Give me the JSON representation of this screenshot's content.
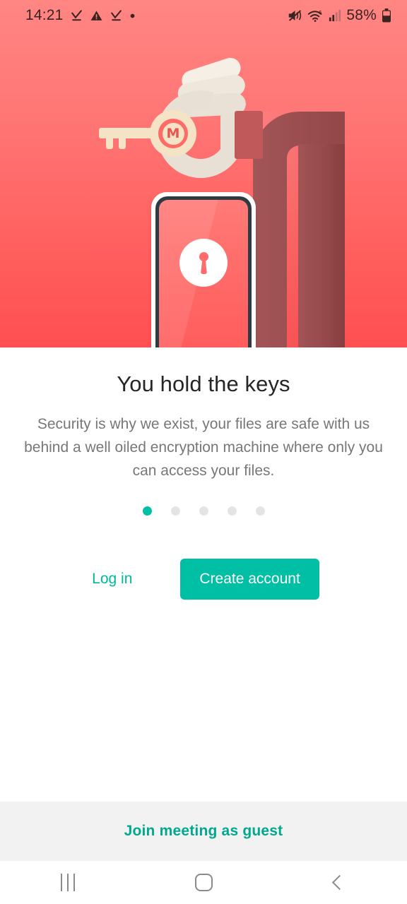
{
  "status_bar": {
    "time": "14:21",
    "battery_percent": "58%",
    "left_icons": [
      "download-complete-icon",
      "warning-triangle-icon",
      "download-complete-icon",
      "dot-indicator-icon"
    ],
    "right_icons": [
      "mute-icon",
      "wifi-6-icon",
      "signal-bars-icon",
      "battery-icon"
    ]
  },
  "illustration": {
    "name": "hand-holding-mega-key-and-locked-phone",
    "key_logo_letter": "M",
    "colors": {
      "background_top": "#FF8683",
      "background_bottom": "#FF4F52",
      "arm": "#9C4B4C",
      "cuff": "#C05A5A",
      "hand": "#E9E0D5",
      "key": "#F4E3C4",
      "phone_frame": "#FFFFFF",
      "phone_bezel": "#2E3A44",
      "phone_screen": "#FF6664",
      "lock_accent": "#FF6B6B"
    }
  },
  "onboarding": {
    "title": "You hold the keys",
    "description": "Security is why we exist, your files are safe with us behind a well oiled encryption machine where only you can access your files.",
    "pager": {
      "total": 5,
      "active_index": 0,
      "active_color": "#00BFA5",
      "inactive_color": "#E4E4E4"
    },
    "login_label": "Log in",
    "create_account_label": "Create account",
    "accent_color": "#00BFA5"
  },
  "guest_bar": {
    "label": "Join meeting as guest",
    "color": "#00A88E",
    "background": "#F2F2F2"
  },
  "nav_bar": {
    "recents_label": "Recents",
    "home_label": "Home",
    "back_label": "Back"
  }
}
